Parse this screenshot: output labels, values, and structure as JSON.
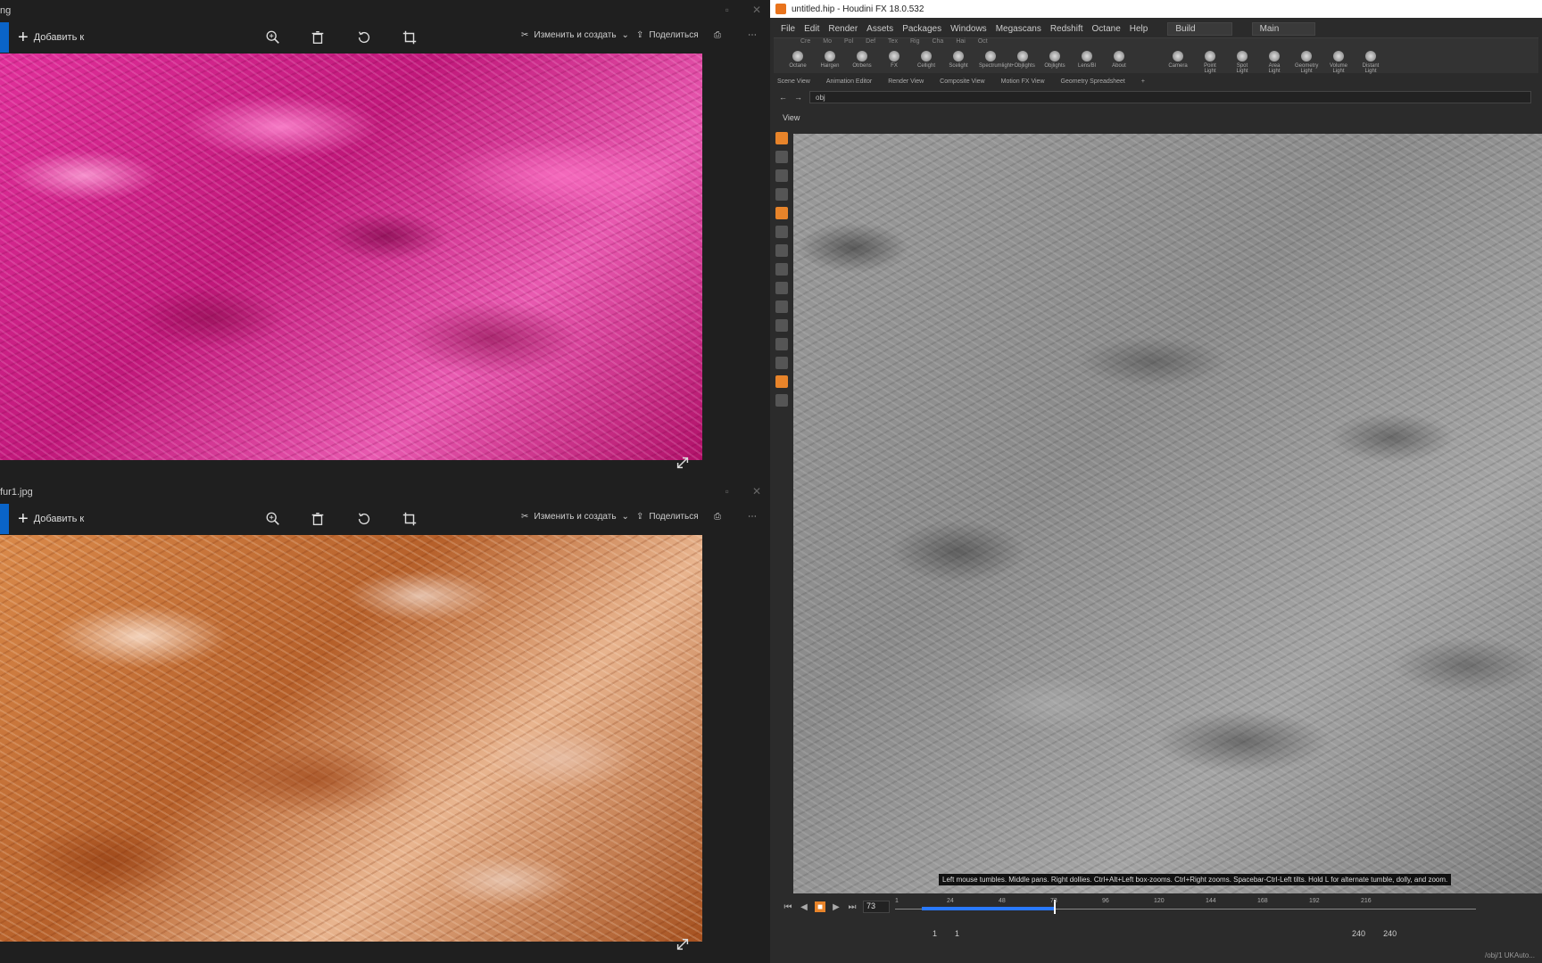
{
  "photos1": {
    "title": "ng",
    "add_label": "Добавить к",
    "edit_label": "Изменить и создать",
    "share_label": "Поделиться"
  },
  "photos2": {
    "title": "fur1.jpg",
    "add_label": "Добавить к",
    "edit_label": "Изменить и создать",
    "share_label": "Поделиться"
  },
  "houdini": {
    "title": "untitled.hip - Houdini FX 18.0.532",
    "menu": [
      "File",
      "Edit",
      "Render",
      "Assets",
      "Packages",
      "Windows",
      "Megascans",
      "Redshift",
      "Octane",
      "Help"
    ],
    "desktop": "Build",
    "desk2": "Main",
    "shelf_tools": [
      "Octane",
      "Hairgen",
      "Otrbens",
      "FX",
      "Cellight",
      "Scelight",
      "Spectrumlight",
      "+Objlights",
      "Objlights",
      "Lens/Bl",
      "About"
    ],
    "light_tools": [
      "Camera",
      "Point Light",
      "Spot Light",
      "Area Light",
      "Geometry Light",
      "Volume Light",
      "Distant Light",
      "Environment Light",
      "Sky Light",
      "GI Light"
    ],
    "pane_tabs": [
      "Scene View",
      "Animation Editor",
      "Render View",
      "Composite View",
      "Motion FX View",
      "Geometry Spreadsheet"
    ],
    "path": "obj",
    "view_label": "View",
    "status": "Left mouse tumbles. Middle pans. Right dollies. Ctrl+Alt+Left box-zooms. Ctrl+Right zooms. Spacebar-Ctrl-Left tilts. Hold L for alternate tumble, dolly, and zoom.",
    "frame": "73",
    "ticks": [
      "1",
      "24",
      "48",
      "73",
      "96",
      "120",
      "144",
      "168",
      "192",
      "216"
    ],
    "range_start": "1",
    "range_start2": "1",
    "range_end": "240",
    "range_end2": "240",
    "footer": "/obj/1 UKAuto..."
  }
}
